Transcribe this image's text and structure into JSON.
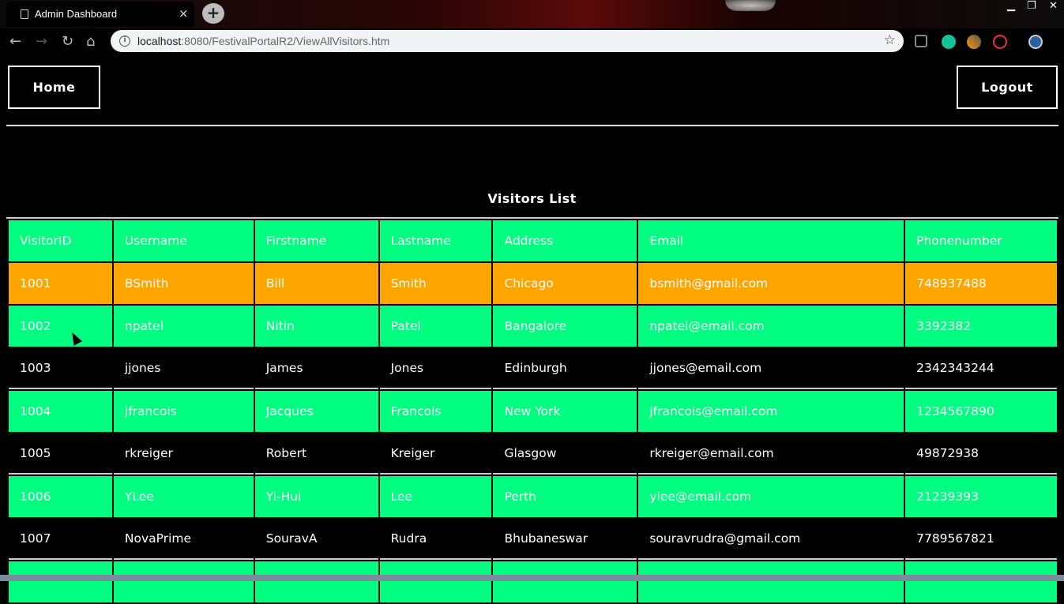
{
  "browser": {
    "tab_title": "Admin Dashboard",
    "tab_close": "×",
    "new_tab": "+",
    "url_host": "localhost",
    "url_rest": ":8080/FestivalPortalR2/ViewAllVisitors.htm",
    "window_minimize": "▁",
    "window_restore": "❐",
    "window_close": "✕"
  },
  "nav": {
    "home_label": "Home",
    "logout_label": "Logout"
  },
  "main": {
    "title": "Visitors List"
  },
  "table": {
    "headers": [
      "VisitorID",
      "Username",
      "Firstname",
      "Lastname",
      "Address",
      "Email",
      "Phonenumber"
    ],
    "rows": [
      [
        "1001",
        "BSmith",
        "Bill",
        "Smith",
        "Chicago",
        "bsmith@gmail.com",
        "748937488"
      ],
      [
        "1002",
        "npatel",
        "Nitin",
        "Patel",
        "Bangalore",
        "npatel@email.com",
        "3392382"
      ],
      [
        "1003",
        "jjones",
        "James",
        "Jones",
        "Edinburgh",
        "jjones@email.com",
        "2342343244"
      ],
      [
        "1004",
        "jfrancois",
        "Jacques",
        "Francois",
        "New York",
        "jfrancois@email.com",
        "1234567890"
      ],
      [
        "1005",
        "rkreiger",
        "Robert",
        "Kreiger",
        "Glasgow",
        "rkreiger@email.com",
        "49872938"
      ],
      [
        "1006",
        "YLee",
        "Yi-Hui",
        "Lee",
        "Perth",
        "ylee@email.com",
        "21239393"
      ],
      [
        "1007",
        "NovaPrime",
        "SouravA",
        "Rudra",
        "Bhubaneswar",
        "souravrudra@gmail.com",
        "7789567821"
      ],
      [
        "",
        "",
        "",
        "",
        "",
        "",
        ""
      ]
    ],
    "row_styles": [
      "orange",
      "green",
      "black",
      "green",
      "black",
      "green",
      "black",
      "green"
    ]
  },
  "colors": {
    "header_bg": "#00ff80",
    "row_green": "#00ff80",
    "row_hover": "#ffa500",
    "page_bg": "#000000"
  },
  "icons": [
    "page-icon",
    "back-arrow-icon",
    "forward-arrow-icon",
    "reload-icon",
    "home-icon",
    "site-info-icon",
    "bookmark-star-icon",
    "grammarly-icon",
    "profile-avatar-icon"
  ]
}
